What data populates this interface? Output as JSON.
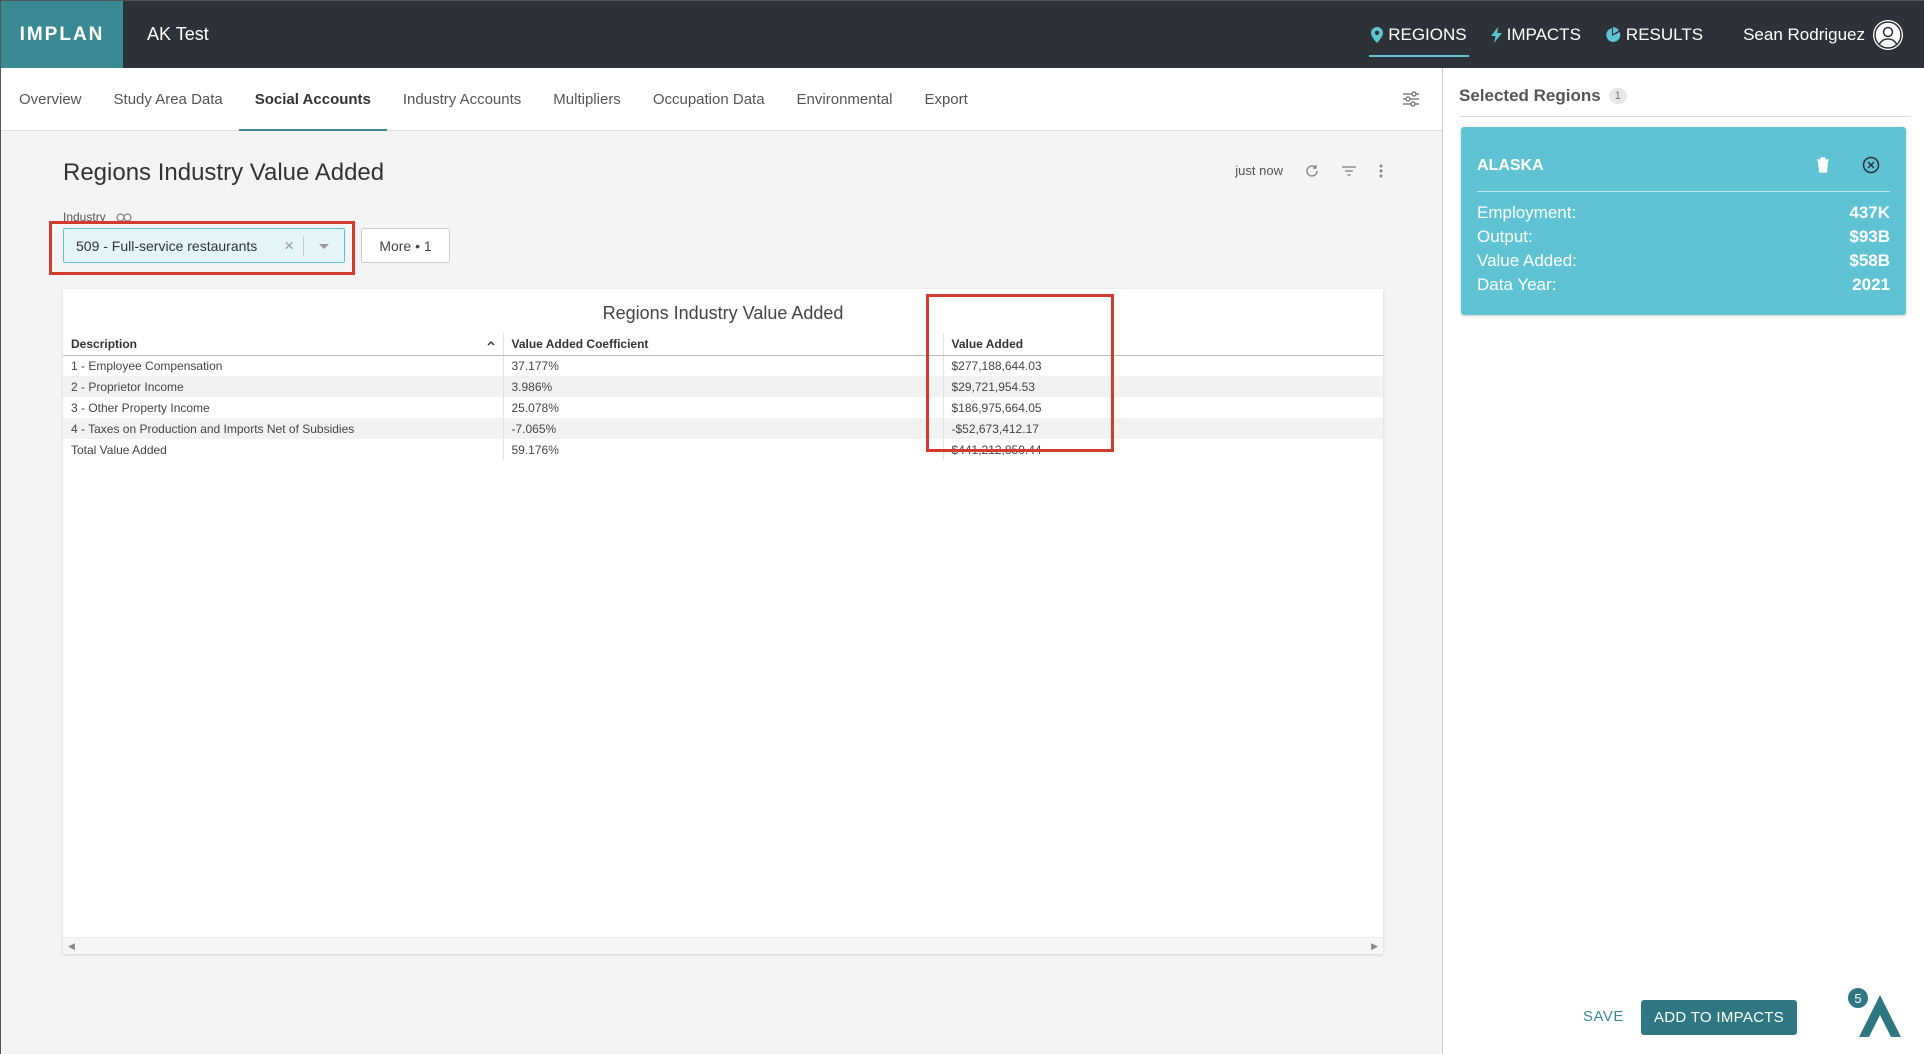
{
  "app": {
    "logo": "IMPLAN",
    "project_name": "AK Test"
  },
  "topnav": {
    "items": [
      {
        "label": "REGIONS",
        "icon": "map-pin-icon"
      },
      {
        "label": "IMPACTS",
        "icon": "bolt-icon"
      },
      {
        "label": "RESULTS",
        "icon": "pie-chart-icon"
      }
    ],
    "user_name": "Sean Rodriguez"
  },
  "subtabs": [
    {
      "label": "Overview"
    },
    {
      "label": "Study Area Data"
    },
    {
      "label": "Social Accounts"
    },
    {
      "label": "Industry Accounts"
    },
    {
      "label": "Multipliers"
    },
    {
      "label": "Occupation Data"
    },
    {
      "label": "Environmental"
    },
    {
      "label": "Export"
    }
  ],
  "report": {
    "title": "Regions Industry Value Added",
    "timestamp": "just now",
    "industry_label": "Industry",
    "industry_value": "509 - Full-service restaurants",
    "more_label": "More • 1",
    "table_title": "Regions Industry Value Added",
    "columns": [
      "Description",
      "Value Added Coefficient",
      "Value Added"
    ],
    "rows": [
      {
        "description": "1 - Employee Compensation",
        "coefficient": "37.177%",
        "value": "$277,188,644.03"
      },
      {
        "description": "2 - Proprietor Income",
        "coefficient": "3.986%",
        "value": "$29,721,954.53"
      },
      {
        "description": "3 - Other Property Income",
        "coefficient": "25.078%",
        "value": "$186,975,664.05"
      },
      {
        "description": "4 - Taxes on Production and Imports Net of Subsidies",
        "coefficient": "-7.065%",
        "value": "-$52,673,412.17"
      },
      {
        "description": "Total Value Added",
        "coefficient": "59.176%",
        "value": "$441,212,850.44"
      }
    ]
  },
  "sidebar": {
    "title": "Selected Regions",
    "count": "1",
    "region": {
      "name": "ALASKA",
      "stats": [
        {
          "label": "Employment:",
          "value": "437K"
        },
        {
          "label": "Output:",
          "value": "$93B"
        },
        {
          "label": "Value Added:",
          "value": "$58B"
        },
        {
          "label": "Data Year:",
          "value": "2021"
        }
      ]
    },
    "save_label": "SAVE",
    "add_label": "ADD TO IMPACTS",
    "help_count": "5"
  },
  "colors": {
    "topbar": "#2d3238",
    "accent": "#5ec3d3",
    "brand_teal": "#3a8a96",
    "highlight_red": "#d23b2e"
  }
}
